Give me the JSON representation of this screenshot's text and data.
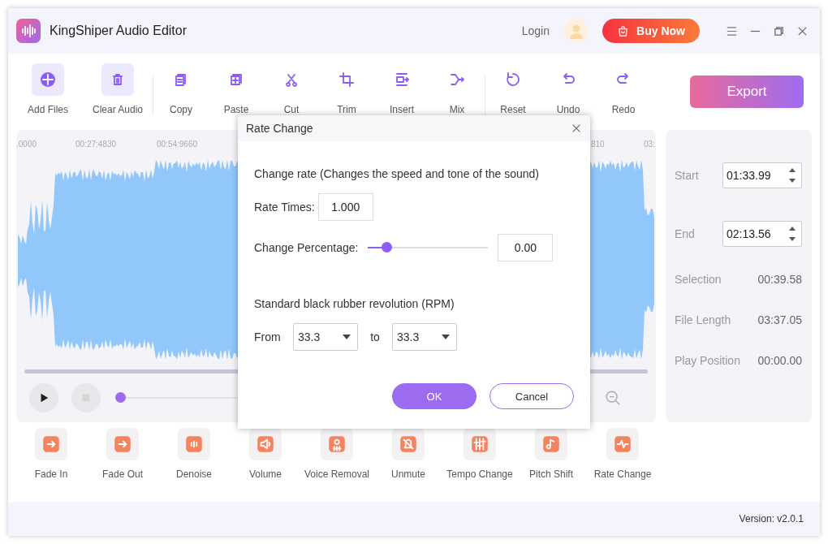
{
  "window": {
    "title": "KingShiper Audio Editor"
  },
  "header": {
    "login": "Login",
    "buy_button": "Buy Now"
  },
  "toolbar": {
    "groups": [
      [
        {
          "label": "Add Files",
          "kind": "tile"
        },
        {
          "label": "Clear Audio",
          "kind": "tile"
        }
      ],
      [
        {
          "label": "Copy",
          "kind": "plain"
        },
        {
          "label": "Paste",
          "kind": "plain"
        },
        {
          "label": "Cut",
          "kind": "plain"
        },
        {
          "label": "Trim",
          "kind": "plain"
        },
        {
          "label": "Insert",
          "kind": "plain"
        },
        {
          "label": "Mix",
          "kind": "plain"
        }
      ],
      [
        {
          "label": "Reset",
          "kind": "plain"
        },
        {
          "label": "Undo",
          "kind": "plain"
        },
        {
          "label": "Redo",
          "kind": "plain"
        }
      ]
    ],
    "export_button": "Export"
  },
  "waveform": {
    "ruler_labels": [
      ".0000",
      "00:27:4830",
      "00:54:9660",
      "810",
      "03:"
    ],
    "position": {
      "level": 0
    }
  },
  "selection_panel": {
    "start": {
      "label": "Start",
      "value": "01:33.99"
    },
    "end": {
      "label": "End",
      "value": "02:13.56"
    },
    "info": [
      {
        "label": "Selection",
        "value": "00:39.58"
      },
      {
        "label": "File Length",
        "value": "03:37.05"
      },
      {
        "label": "Play Position",
        "value": "00:00.00"
      }
    ]
  },
  "effects": [
    "Fade In",
    "Fade Out",
    "Denoise",
    "Volume",
    "Voice Removal",
    "Unmute",
    "Tempo Change",
    "Pitch Shift",
    "Rate Change"
  ],
  "dialog": {
    "title": "Rate Change",
    "description": "Change rate (Changes the speed and tone of the sound)",
    "rate_label": "Rate Times:",
    "rate_value": "1.000",
    "percent_label": "Change Percentage:",
    "percent_slider": {
      "level": 0.15
    },
    "percent_value": "0.00",
    "rpm_heading": "Standard black rubber revolution (RPM)",
    "from_label": "From",
    "from_value": "33.3",
    "to_label": "to",
    "to_value": "33.3",
    "ok": "OK",
    "cancel": "Cancel"
  },
  "status_bar": {
    "version": "Version: v2.0.1"
  }
}
